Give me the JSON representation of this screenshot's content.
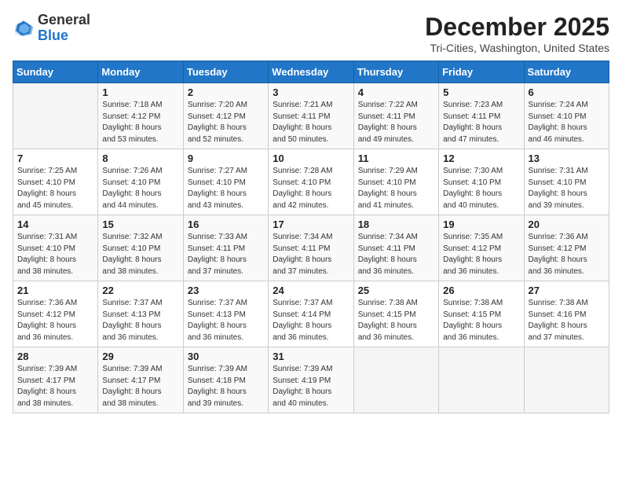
{
  "header": {
    "logo_general": "General",
    "logo_blue": "Blue",
    "main_title": "December 2025",
    "subtitle": "Tri-Cities, Washington, United States"
  },
  "days_of_week": [
    "Sunday",
    "Monday",
    "Tuesday",
    "Wednesday",
    "Thursday",
    "Friday",
    "Saturday"
  ],
  "weeks": [
    [
      {
        "day": "",
        "info": ""
      },
      {
        "day": "1",
        "info": "Sunrise: 7:18 AM\nSunset: 4:12 PM\nDaylight: 8 hours\nand 53 minutes."
      },
      {
        "day": "2",
        "info": "Sunrise: 7:20 AM\nSunset: 4:12 PM\nDaylight: 8 hours\nand 52 minutes."
      },
      {
        "day": "3",
        "info": "Sunrise: 7:21 AM\nSunset: 4:11 PM\nDaylight: 8 hours\nand 50 minutes."
      },
      {
        "day": "4",
        "info": "Sunrise: 7:22 AM\nSunset: 4:11 PM\nDaylight: 8 hours\nand 49 minutes."
      },
      {
        "day": "5",
        "info": "Sunrise: 7:23 AM\nSunset: 4:11 PM\nDaylight: 8 hours\nand 47 minutes."
      },
      {
        "day": "6",
        "info": "Sunrise: 7:24 AM\nSunset: 4:10 PM\nDaylight: 8 hours\nand 46 minutes."
      }
    ],
    [
      {
        "day": "7",
        "info": "Sunrise: 7:25 AM\nSunset: 4:10 PM\nDaylight: 8 hours\nand 45 minutes."
      },
      {
        "day": "8",
        "info": "Sunrise: 7:26 AM\nSunset: 4:10 PM\nDaylight: 8 hours\nand 44 minutes."
      },
      {
        "day": "9",
        "info": "Sunrise: 7:27 AM\nSunset: 4:10 PM\nDaylight: 8 hours\nand 43 minutes."
      },
      {
        "day": "10",
        "info": "Sunrise: 7:28 AM\nSunset: 4:10 PM\nDaylight: 8 hours\nand 42 minutes."
      },
      {
        "day": "11",
        "info": "Sunrise: 7:29 AM\nSunset: 4:10 PM\nDaylight: 8 hours\nand 41 minutes."
      },
      {
        "day": "12",
        "info": "Sunrise: 7:30 AM\nSunset: 4:10 PM\nDaylight: 8 hours\nand 40 minutes."
      },
      {
        "day": "13",
        "info": "Sunrise: 7:31 AM\nSunset: 4:10 PM\nDaylight: 8 hours\nand 39 minutes."
      }
    ],
    [
      {
        "day": "14",
        "info": "Sunrise: 7:31 AM\nSunset: 4:10 PM\nDaylight: 8 hours\nand 38 minutes."
      },
      {
        "day": "15",
        "info": "Sunrise: 7:32 AM\nSunset: 4:10 PM\nDaylight: 8 hours\nand 38 minutes."
      },
      {
        "day": "16",
        "info": "Sunrise: 7:33 AM\nSunset: 4:11 PM\nDaylight: 8 hours\nand 37 minutes."
      },
      {
        "day": "17",
        "info": "Sunrise: 7:34 AM\nSunset: 4:11 PM\nDaylight: 8 hours\nand 37 minutes."
      },
      {
        "day": "18",
        "info": "Sunrise: 7:34 AM\nSunset: 4:11 PM\nDaylight: 8 hours\nand 36 minutes."
      },
      {
        "day": "19",
        "info": "Sunrise: 7:35 AM\nSunset: 4:12 PM\nDaylight: 8 hours\nand 36 minutes."
      },
      {
        "day": "20",
        "info": "Sunrise: 7:36 AM\nSunset: 4:12 PM\nDaylight: 8 hours\nand 36 minutes."
      }
    ],
    [
      {
        "day": "21",
        "info": "Sunrise: 7:36 AM\nSunset: 4:12 PM\nDaylight: 8 hours\nand 36 minutes."
      },
      {
        "day": "22",
        "info": "Sunrise: 7:37 AM\nSunset: 4:13 PM\nDaylight: 8 hours\nand 36 minutes."
      },
      {
        "day": "23",
        "info": "Sunrise: 7:37 AM\nSunset: 4:13 PM\nDaylight: 8 hours\nand 36 minutes."
      },
      {
        "day": "24",
        "info": "Sunrise: 7:37 AM\nSunset: 4:14 PM\nDaylight: 8 hours\nand 36 minutes."
      },
      {
        "day": "25",
        "info": "Sunrise: 7:38 AM\nSunset: 4:15 PM\nDaylight: 8 hours\nand 36 minutes."
      },
      {
        "day": "26",
        "info": "Sunrise: 7:38 AM\nSunset: 4:15 PM\nDaylight: 8 hours\nand 36 minutes."
      },
      {
        "day": "27",
        "info": "Sunrise: 7:38 AM\nSunset: 4:16 PM\nDaylight: 8 hours\nand 37 minutes."
      }
    ],
    [
      {
        "day": "28",
        "info": "Sunrise: 7:39 AM\nSunset: 4:17 PM\nDaylight: 8 hours\nand 38 minutes."
      },
      {
        "day": "29",
        "info": "Sunrise: 7:39 AM\nSunset: 4:17 PM\nDaylight: 8 hours\nand 38 minutes."
      },
      {
        "day": "30",
        "info": "Sunrise: 7:39 AM\nSunset: 4:18 PM\nDaylight: 8 hours\nand 39 minutes."
      },
      {
        "day": "31",
        "info": "Sunrise: 7:39 AM\nSunset: 4:19 PM\nDaylight: 8 hours\nand 40 minutes."
      },
      {
        "day": "",
        "info": ""
      },
      {
        "day": "",
        "info": ""
      },
      {
        "day": "",
        "info": ""
      }
    ]
  ]
}
